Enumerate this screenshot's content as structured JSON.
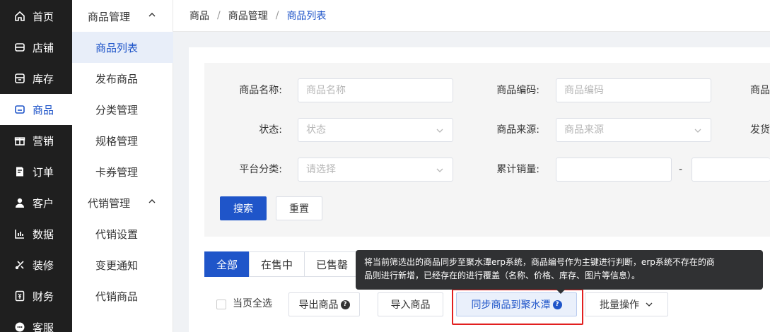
{
  "nav": {
    "items": [
      {
        "label": "首页",
        "icon": "home-icon"
      },
      {
        "label": "店铺",
        "icon": "store-icon"
      },
      {
        "label": "库存",
        "icon": "inventory-icon"
      },
      {
        "label": "商品",
        "icon": "product-icon",
        "active": true
      },
      {
        "label": "营销",
        "icon": "gift-icon"
      },
      {
        "label": "订单",
        "icon": "order-icon"
      },
      {
        "label": "客户",
        "icon": "user-icon"
      },
      {
        "label": "数据",
        "icon": "chart-icon"
      },
      {
        "label": "装修",
        "icon": "decorate-icon"
      },
      {
        "label": "财务",
        "icon": "finance-icon"
      },
      {
        "label": "客服",
        "icon": "service-icon"
      }
    ]
  },
  "subnav": {
    "group1": "商品管理",
    "group1_items": [
      "商品列表",
      "发布商品",
      "分类管理",
      "规格管理",
      "卡券管理"
    ],
    "group2": "代销管理",
    "group2_items": [
      "代销设置",
      "变更通知",
      "代销商品"
    ]
  },
  "breadcrumb": {
    "items": [
      "商品",
      "商品管理"
    ],
    "current": "商品列表",
    "sep": "/"
  },
  "filters": {
    "name_label": "商品名称:",
    "name_placeholder": "商品名称",
    "code_label": "商品编码:",
    "code_placeholder": "商品编码",
    "col3_label_partial": "商品",
    "status_label": "状态:",
    "status_placeholder": "状态",
    "source_label": "商品来源:",
    "source_placeholder": "商品来源",
    "col3_row2_partial": "发货",
    "category_label": "平台分类:",
    "category_placeholder": "请选择",
    "sales_label": "累计销量:",
    "sales_dash": "-"
  },
  "buttons": {
    "search": "搜索",
    "reset": "重置"
  },
  "tabs": [
    "全部",
    "在售中",
    "已售罄"
  ],
  "actions": {
    "select_all": "当页全选",
    "export": "导出商品",
    "import": "导入商品",
    "sync": "同步商品到聚水潭",
    "batch": "批量操作",
    "help_glyph": "?"
  },
  "tooltip": {
    "line1": "将当前筛选出的商品同步至聚水潭erp系统，商品编号作为主键进行判断，erp系统不存在的商",
    "line2": "品则进行新增，已经存在的进行覆盖（名称、价格、库存、图片等信息）。"
  },
  "colors": {
    "brand": "#1f55c9",
    "nav_bg": "#1f1f1f",
    "highlight": "#e21f1f",
    "tooltip_bg": "#303133"
  }
}
